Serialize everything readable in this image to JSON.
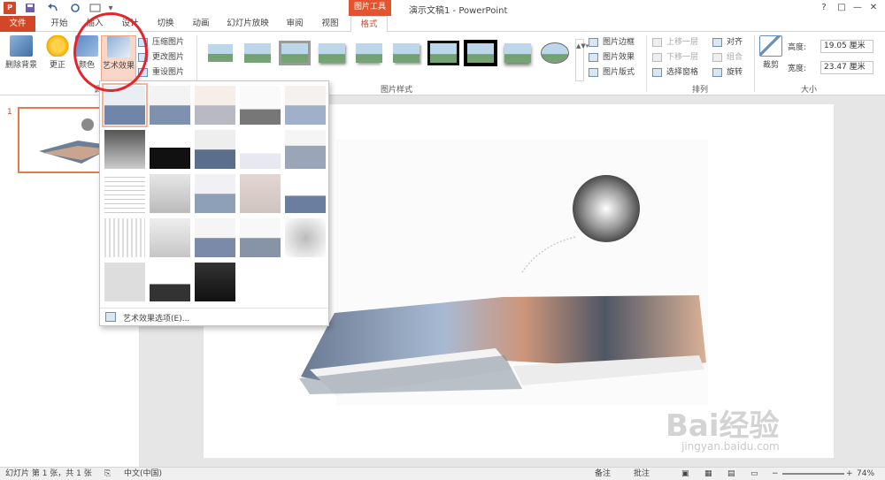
{
  "app": {
    "title": "演示文稿1 - PowerPoint",
    "context_tab": "图片工具"
  },
  "title_buttons": {
    "help": "?",
    "restore": "□",
    "minimize": "—",
    "maximize": "□",
    "close": "✕"
  },
  "tabs": [
    "文件",
    "开始",
    "插入",
    "设计",
    "切换",
    "动画",
    "幻灯片放映",
    "审阅",
    "视图",
    "格式"
  ],
  "ribbon": {
    "remove_bg": "删除背景",
    "correct": "更正",
    "color": "颜色",
    "artistic": "艺术效果",
    "compress": "压缩图片",
    "change": "更改图片",
    "reset": "重设图片",
    "adjust_group": "调整",
    "styles_group": "图片样式",
    "border": "图片边框",
    "effects": "图片效果",
    "layout": "图片版式",
    "bring_forward": "上移一层",
    "send_backward": "下移一层",
    "selection_pane": "选择窗格",
    "align": "对齐",
    "group": "组合",
    "rotate": "旋转",
    "arrange_group": "排列",
    "crop": "裁剪",
    "height_label": "高度:",
    "height_value": "19.05 厘米",
    "width_label": "宽度:",
    "width_value": "23.47 厘米",
    "size_group": "大小"
  },
  "dropdown": {
    "footer": "艺术效果选项(E)..."
  },
  "slide_pane": {
    "number": "1"
  },
  "status": {
    "slide_info": "幻灯片 第 1 张，共 1 张",
    "language": "中文(中国)",
    "notes": "备注",
    "comments": "批注",
    "zoom": "74%"
  },
  "watermark": {
    "brand": "Bai经验",
    "url": "jingyan.baidu.com"
  },
  "colors": {
    "accent": "#d24726",
    "context": "#e3532d",
    "highlight_circle": "#e8232c"
  }
}
